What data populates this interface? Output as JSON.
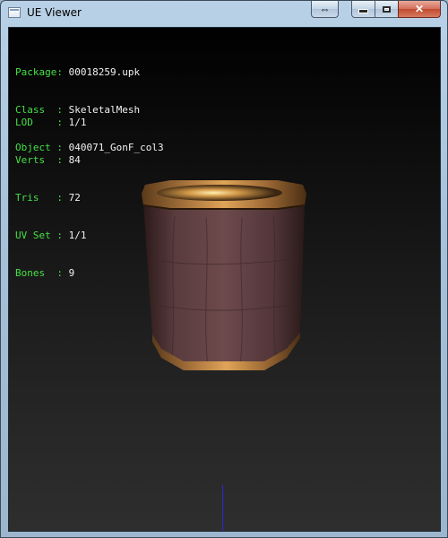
{
  "window": {
    "title": "UE Viewer"
  },
  "titlebar_buttons": {
    "swap": "⇔",
    "close": "✕"
  },
  "info": {
    "package": {
      "label": "Package",
      "value": "00018259.upk"
    },
    "class": {
      "label": "Class  ",
      "value": "SkeletalMesh"
    },
    "object": {
      "label": "Object ",
      "value": "040071_GonF_col3"
    },
    "lod": {
      "label": "LOD    ",
      "value": "1/1"
    },
    "verts": {
      "label": "Verts  ",
      "value": "84"
    },
    "tris": {
      "label": "Tris   ",
      "value": "72"
    },
    "uvset": {
      "label": "UV Set ",
      "value": "1/1"
    },
    "bones": {
      "label": "Bones  ",
      "value": "9"
    }
  },
  "colors": {
    "info_key": "#46e046",
    "info_value": "#f2f2f2",
    "axis": "#2a2ad6",
    "rim": "#c8873c"
  },
  "icons": {
    "app": "window-app-icon",
    "swap": "swap-arrows-icon",
    "minimize": "minimize-icon",
    "maximize": "maximize-icon",
    "close": "close-icon"
  }
}
